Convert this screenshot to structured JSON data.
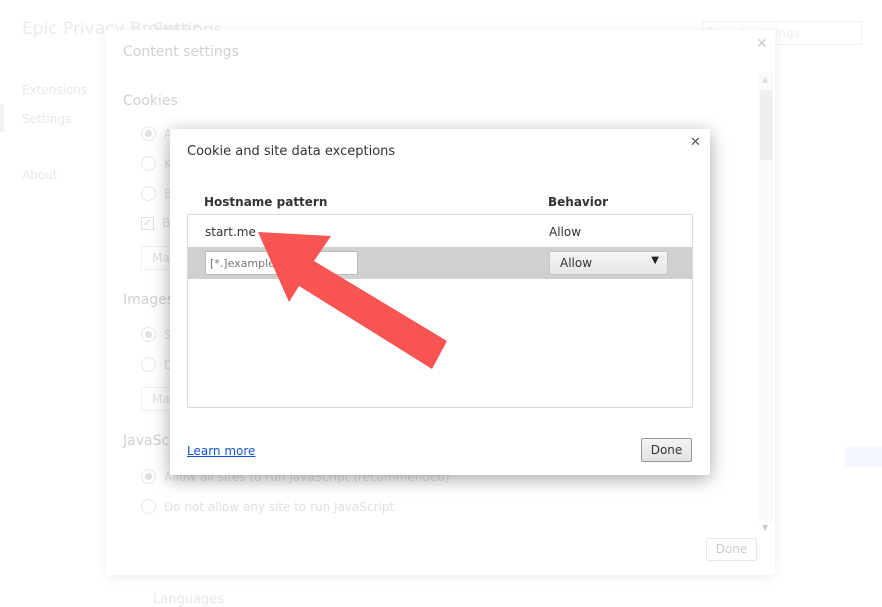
{
  "background": {
    "brand": "Epic Privacy Browser",
    "title": "Settings",
    "nav": [
      "Extensions",
      "Settings",
      "About"
    ],
    "search_placeholder": "Search settings",
    "languages": "Languages"
  },
  "content_settings": {
    "title": "Content settings",
    "cookies": {
      "heading": "Cookies",
      "options": [
        "A",
        "K",
        "B",
        "B"
      ],
      "manage": "Ma"
    },
    "images": {
      "heading": "Images",
      "options": [
        "S",
        "D"
      ],
      "manage": "Ma"
    },
    "javascript": {
      "heading": "JavaScript",
      "options": [
        "Allow all sites to run JavaScript (recommended)",
        "Do not allow any site to run JavaScript"
      ]
    },
    "done": "Done"
  },
  "dialog": {
    "title": "Cookie and site data exceptions",
    "columns": {
      "hostname": "Hostname pattern",
      "behavior": "Behavior"
    },
    "rows": [
      {
        "host": "start.me",
        "behavior": "Allow"
      }
    ],
    "new_row": {
      "placeholder": "[*.]example.com",
      "behavior": "Allow"
    },
    "learn_more": "Learn more",
    "done": "Done"
  },
  "annotation": {
    "type": "arrow",
    "color": "#f75452"
  }
}
